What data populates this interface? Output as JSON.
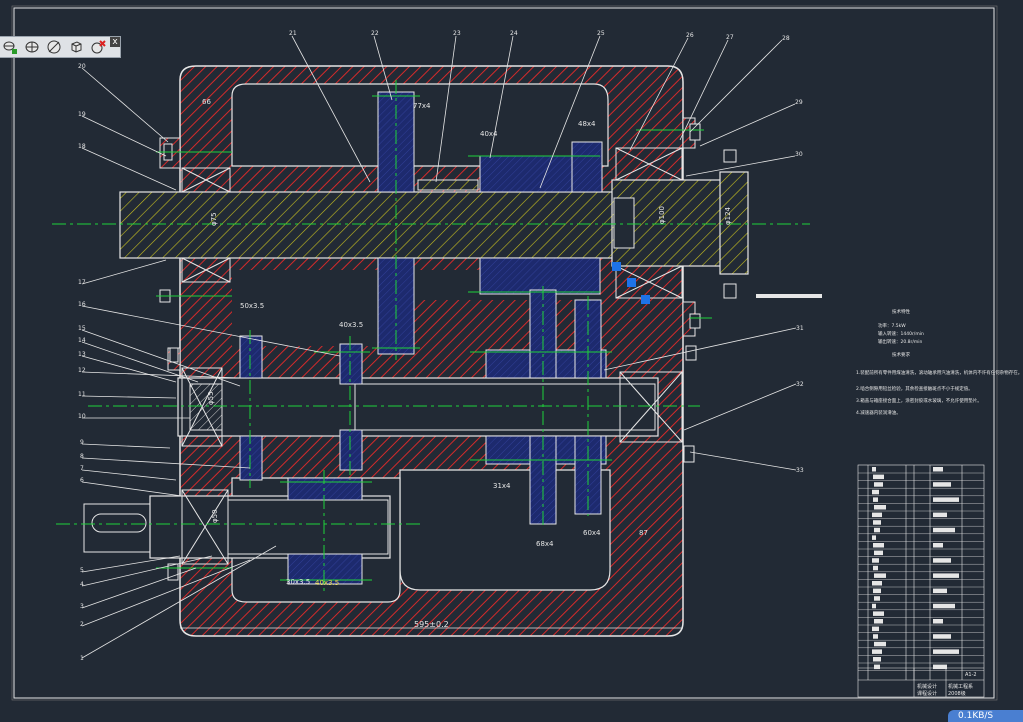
{
  "toolbar": {
    "buttons": [
      {
        "name": "layer-add-icon",
        "label": "Add layer"
      },
      {
        "name": "layer-properties-icon",
        "label": "Layer properties"
      },
      {
        "name": "layer-off-icon",
        "label": "Layer off"
      },
      {
        "name": "view-cube-icon",
        "label": "View"
      },
      {
        "name": "layer-delete-icon",
        "label": "Delete layer"
      }
    ],
    "close_label": "x"
  },
  "drawing": {
    "balloons": [
      "21",
      "22",
      "23",
      "24",
      "25",
      "26",
      "27",
      "28",
      "29",
      "30",
      "20",
      "19",
      "18",
      "17",
      "16",
      "15",
      "14",
      "13",
      "12",
      "11",
      "10",
      "9",
      "8",
      "7",
      "6",
      "5",
      "4",
      "3",
      "2",
      "1",
      "31",
      "32",
      "33"
    ],
    "dims": {
      "d1": "66",
      "d2": "77x4",
      "d3": "40x4",
      "d4": "48x4",
      "d5": "φ75",
      "d6": "φ100",
      "d7": "φ124",
      "d8": "50x3.5",
      "d9": "40x3.5",
      "d10": "φ55",
      "d11": "φ50",
      "d12": "31x4",
      "d13": "68x4",
      "d14": "60x4",
      "d15": "87",
      "d16": "30x3.5",
      "d17": "40x3.5",
      "d18": "595±0.2"
    },
    "notes": {
      "heading": "技术特性",
      "lines": [
        "功率：7.5kW",
        "输入转速：1440r/min",
        "输出转速：20.8r/min"
      ],
      "req_heading": "技术要求",
      "reqs": [
        "1.装配前所有零件用煤油清洗，滚动轴承用汽油清洗，机体内不许有任何杂物存在。",
        "2.啮合侧隙用铅丝检验，其余检查接触斑点不小于规定值。",
        "3.箱盖与箱座接合面上，涂密封胶或水玻璃，不允许使用垫片。",
        "4.减速器内装润滑油。"
      ]
    },
    "title_block": {
      "t1": "机械设计",
      "t2": "课程设计",
      "t3": "机械工程系",
      "t4": "2008级",
      "t5": "A1-2"
    }
  },
  "status": {
    "text": "0.1KB/S"
  },
  "colors": {
    "background": "#222a35",
    "red": "#d42a2a",
    "yellow": "#c8c020",
    "green": "#1fd23a",
    "white": "#e6e6e6",
    "navy": "#1d2a6e",
    "cyan": "#19c6c6"
  }
}
